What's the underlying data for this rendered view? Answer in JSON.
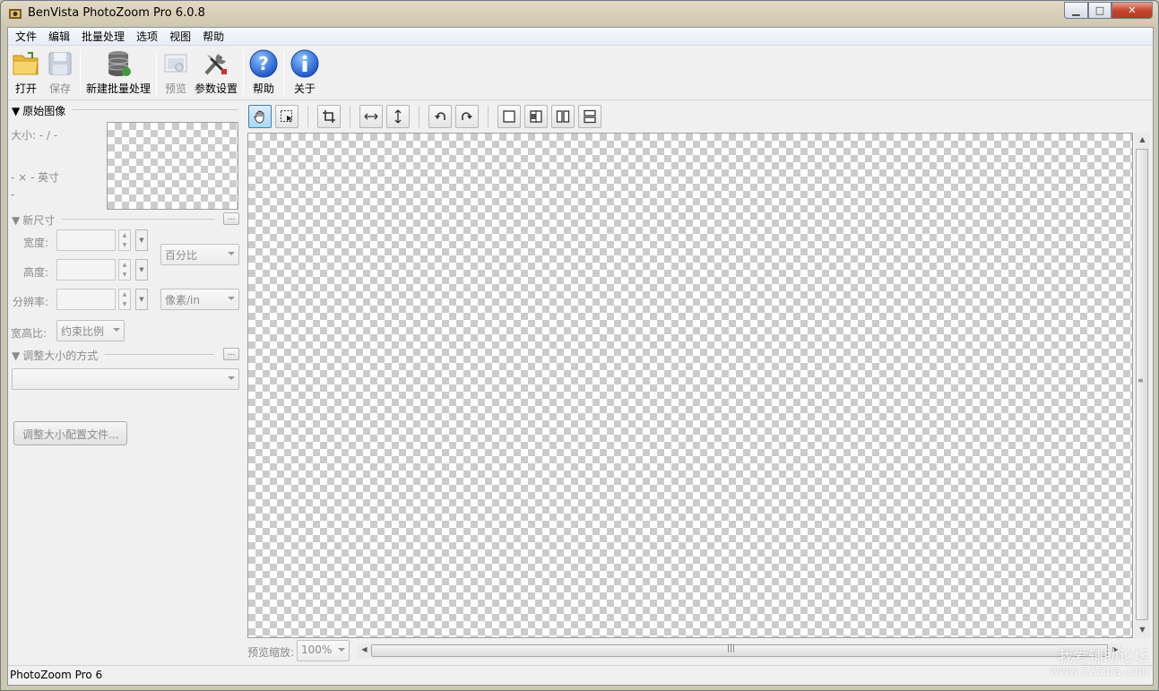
{
  "window": {
    "title": "BenVista PhotoZoom Pro 6.0.8",
    "min_glyph": "▁",
    "max_glyph": "□",
    "close_glyph": "✕"
  },
  "menu": [
    "文件",
    "编辑",
    "批量处理",
    "选项",
    "视图",
    "帮助"
  ],
  "toolbar": {
    "open": "打开",
    "save": "保存",
    "new_batch": "新建批量处理",
    "preview": "预览",
    "settings": "参数设置",
    "help": "帮助",
    "about": "关于"
  },
  "original": {
    "header": "原始图像",
    "size": "大小: - / -",
    "dims": "- × - 英寸",
    "dash": "-"
  },
  "new_size": {
    "header": "新尺寸",
    "width_label": "宽度:",
    "height_label": "高度:",
    "resolution_label": "分辨率:",
    "unit_select": "百分比",
    "res_unit_select": "像素/in",
    "aspect_label": "宽高比:",
    "aspect_select": "约束比例",
    "more": "..."
  },
  "resize_method": {
    "header": "调整大小的方式",
    "select": "",
    "more": "...",
    "profile_button": "调整大小配置文件..."
  },
  "preview_zoom": {
    "label": "预览缩放:",
    "value": "100%"
  },
  "status": {
    "text": "PhotoZoom Pro 6"
  },
  "watermark": {
    "line1": "我爱辅助论坛",
    "line2": "www.52fzba.com"
  }
}
